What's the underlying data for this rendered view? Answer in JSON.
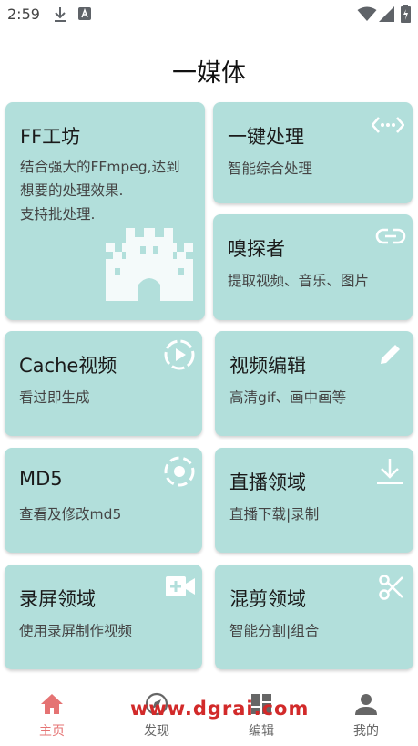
{
  "status_bar": {
    "time": "2:59",
    "icons": [
      "download-icon",
      "notification-a-icon",
      "wifi-icon",
      "signal-icon",
      "battery-icon"
    ]
  },
  "header": {
    "title": "一媒体"
  },
  "cards": {
    "ff_workshop": {
      "title": "FF工坊",
      "desc_1": "结合强大的FFmpeg,达到",
      "desc_2": "想要的处理效果.",
      "desc_3": "支持批处理.",
      "icon": "castle-icon"
    },
    "one_click": {
      "title": "一键处理",
      "desc": "智能综合处理",
      "icon": "code-dots-icon"
    },
    "sniffer": {
      "title": "嗅探者",
      "desc": "提取视频、音乐、图片",
      "icon": "link-icon"
    },
    "cache_video": {
      "title": "Cache视频",
      "desc": "看过即生成",
      "icon": "play-circle-icon"
    },
    "video_edit": {
      "title": "视频编辑",
      "desc": "高清gif、画中画等",
      "icon": "pencil-icon"
    },
    "md5": {
      "title": "MD5",
      "desc": "查看及修改md5",
      "icon": "target-icon"
    },
    "live": {
      "title": "直播领域",
      "desc": "直播下载|录制",
      "icon": "download-icon"
    },
    "screen_record": {
      "title": "录屏领域",
      "desc": "使用录屏制作视频",
      "icon": "video-camera-icon"
    },
    "mix_cut": {
      "title": "混剪领域",
      "desc": "智能分割|组合",
      "icon": "scissors-icon"
    }
  },
  "bottom_nav": {
    "home": {
      "label": "主页",
      "icon": "home-icon"
    },
    "discover": {
      "label": "发现",
      "icon": "compass-icon"
    },
    "edit": {
      "label": "编辑",
      "icon": "dashboard-icon"
    },
    "mine": {
      "label": "我的",
      "icon": "person-icon"
    }
  },
  "watermark": {
    "text": "www.dgrai.com"
  },
  "colors": {
    "card_bg": "#b2dfdb",
    "card_icon": "#ffffff",
    "nav_active": "#e57373",
    "nav_inactive": "#666666"
  }
}
